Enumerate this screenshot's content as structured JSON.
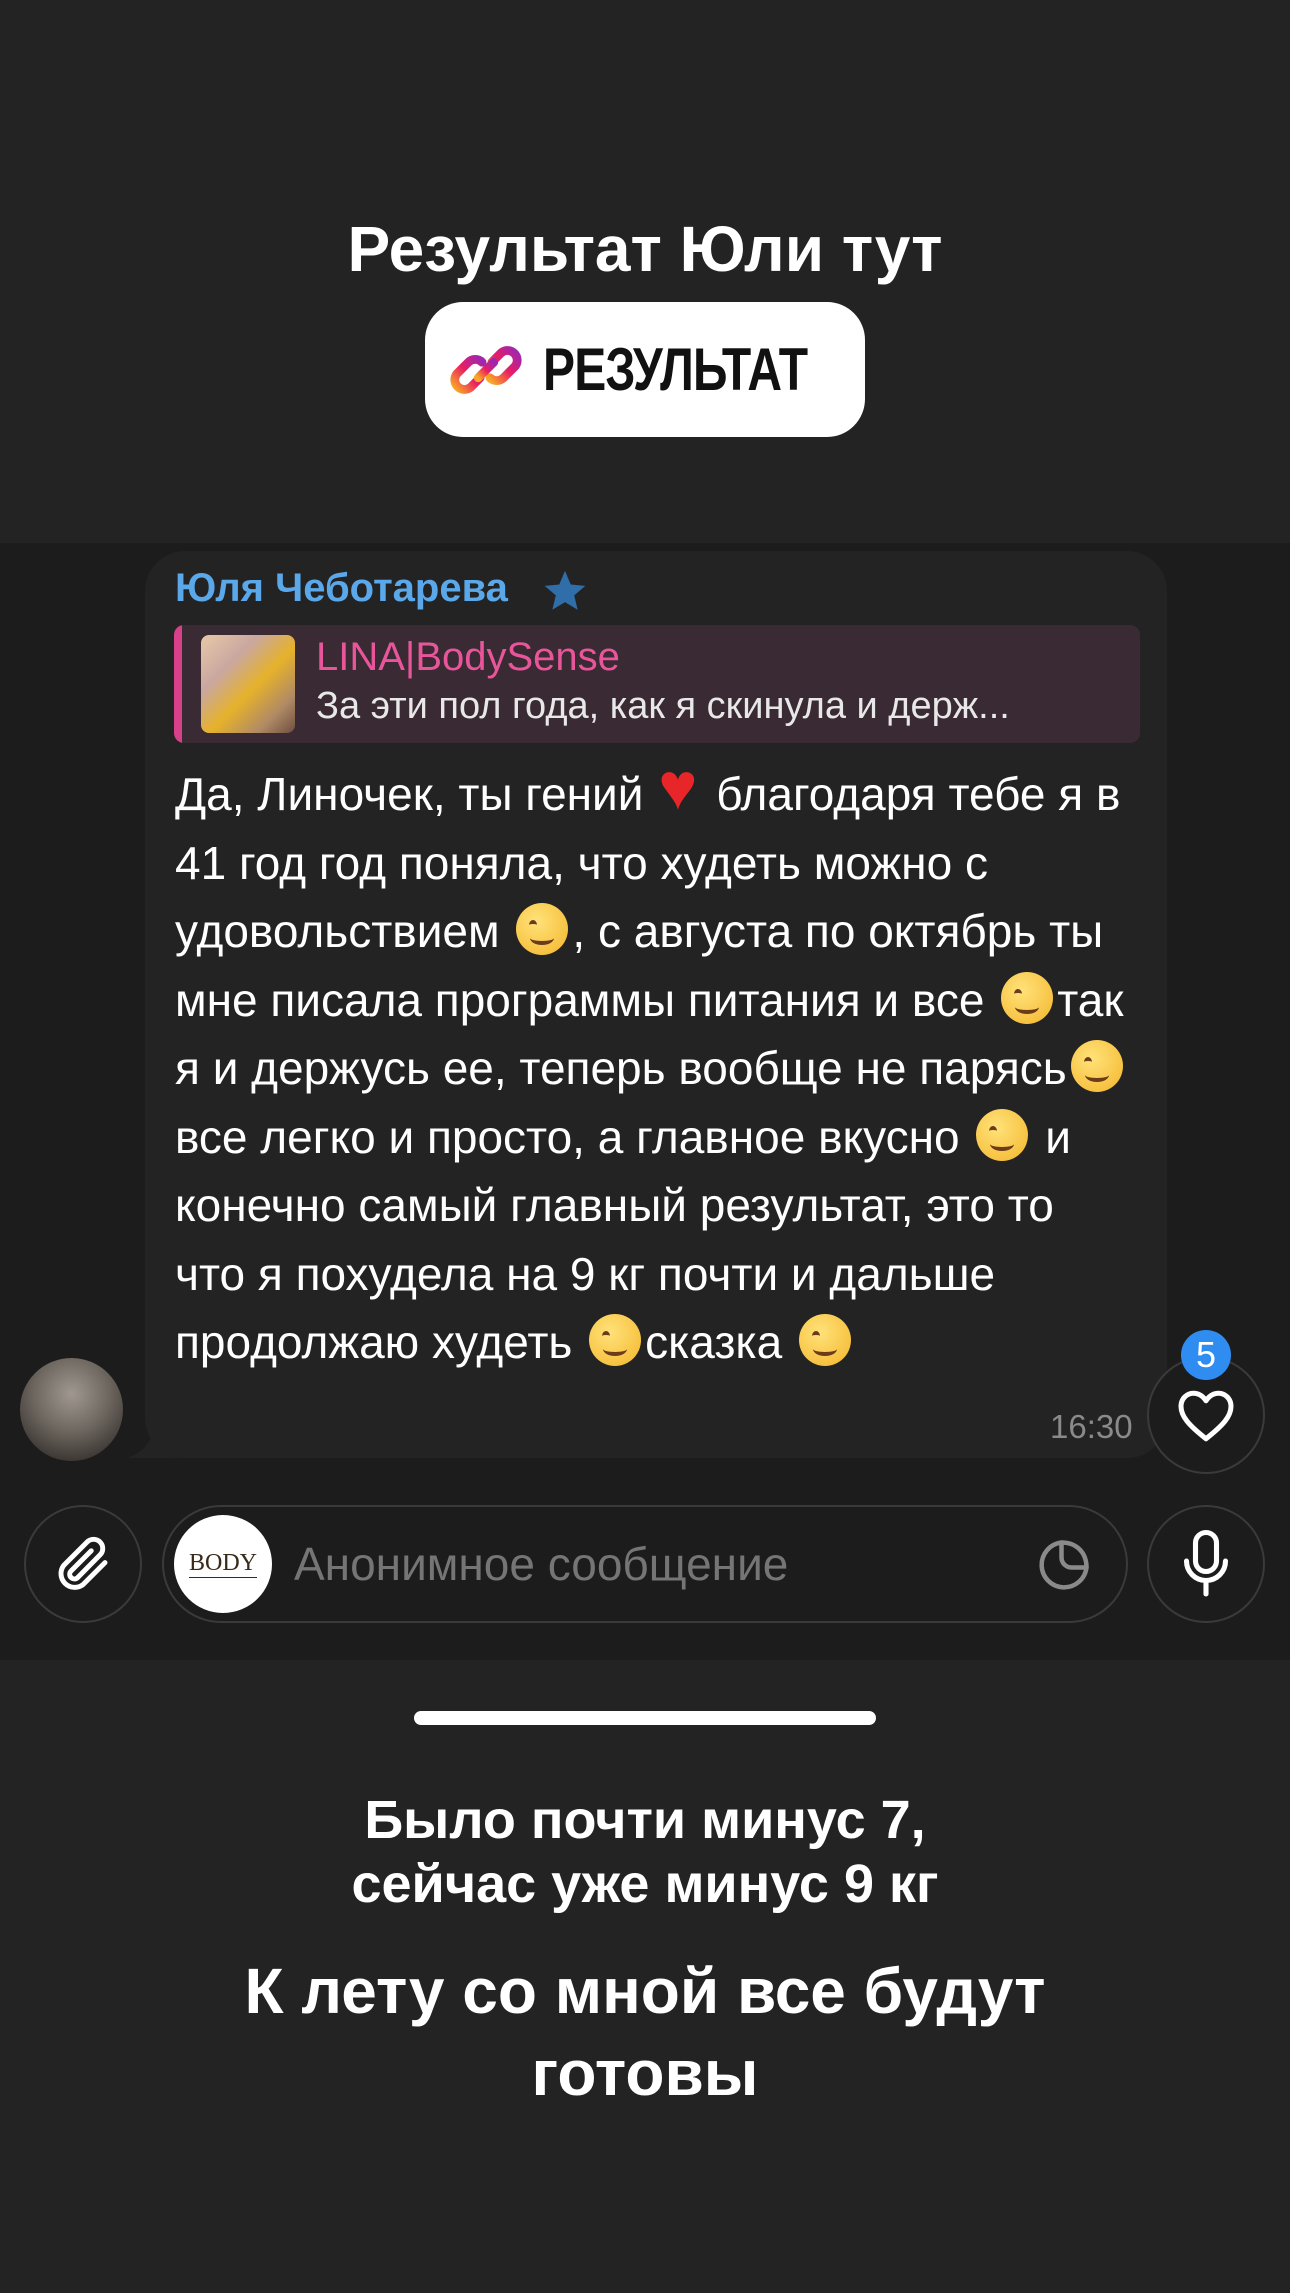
{
  "story": {
    "headline": "Результат Юли тут",
    "link_sticker_label": "РЕЗУЛЬТАТ",
    "caption_top_line1": "Было почти минус 7,",
    "caption_top_line2": "сейчас уже минус 9 кг",
    "caption_bottom_line1": "К лету со мной все будут",
    "caption_bottom_line2": "готовы"
  },
  "message": {
    "sender": "Юля Чеботарева",
    "reply_title": "LINA|BodySense",
    "reply_snippet": "За эти пол года, как я скинула и держ...",
    "body": {
      "s1": "Да, Линочек, ты гений ",
      "s2": "благодаря тебе я в 41 год год поняла, что худеть можно с удовольствием ",
      "s3": ", с августа по октябрь ты мне писала  программы питания и все ",
      "s4": "так я и держусь ее, теперь вообще не парясь",
      "s5": "все легко и просто, а главное вкусно ",
      "s6": " и конечно самый главный результат, это то что я похудела на 9 кг почти и дальше продолжаю худеть ",
      "s7": "сказка "
    },
    "time": "16:30",
    "like_count": "5"
  },
  "composer": {
    "channel_avatar_text": "BODY",
    "placeholder": "Анонимное сообщение"
  },
  "colors": {
    "background": "#232323",
    "chat_background": "#1c1c1c",
    "sender_name": "#5aa8ea",
    "reply_accent": "#d6418a",
    "badge": "#2f8df2"
  },
  "icons": [
    "link-icon",
    "star-icon",
    "heart-icon",
    "paperclip-icon",
    "sticker-icon",
    "microphone-icon"
  ]
}
